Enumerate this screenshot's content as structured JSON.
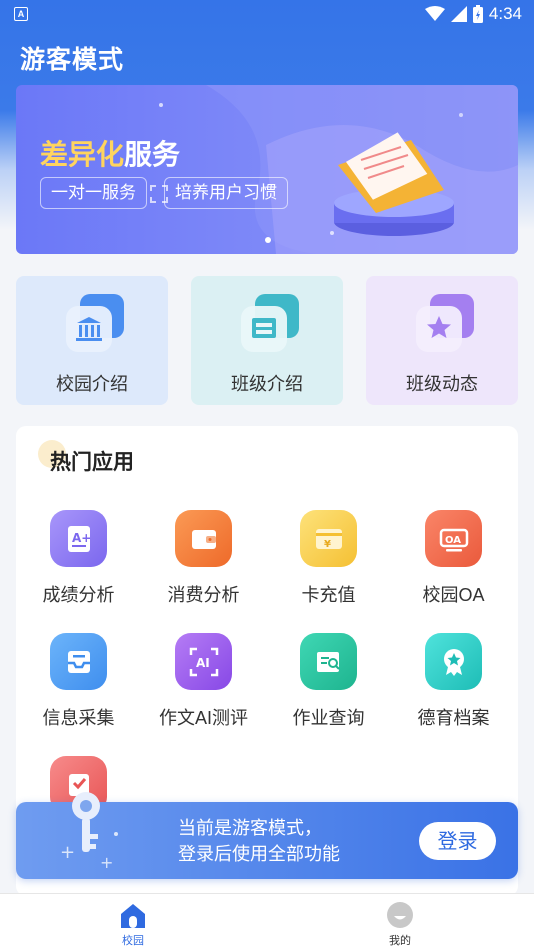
{
  "status_bar": {
    "time": "4:34",
    "indicator": "A"
  },
  "header": {
    "title": "游客模式"
  },
  "banner": {
    "title_highlight": "差异化",
    "title_rest": "服务",
    "tags": [
      "一对一服务",
      "培养用户习惯"
    ],
    "page_indicator": {
      "current": 1,
      "total": 1
    }
  },
  "quick_links": [
    {
      "label": "校园介绍",
      "icon": "school-building-icon",
      "color": "#4a8ef0"
    },
    {
      "label": "班级介绍",
      "icon": "class-board-icon",
      "color": "#3fb8c8"
    },
    {
      "label": "班级动态",
      "icon": "star-icon",
      "color": "#a47ff0"
    }
  ],
  "hot_apps": {
    "title": "热门应用",
    "items": [
      {
        "label": "成绩分析",
        "icon": "grade-a-plus-icon",
        "color": "#8f7cf5"
      },
      {
        "label": "消费分析",
        "icon": "wallet-icon",
        "color": "#f27a3a"
      },
      {
        "label": "卡充值",
        "icon": "card-recharge-icon",
        "color": "#f5c542"
      },
      {
        "label": "校园OA",
        "icon": "oa-icon",
        "color": "#f06a4e"
      },
      {
        "label": "信息采集",
        "icon": "inbox-icon",
        "color": "#4a9cf2"
      },
      {
        "label": "作文AI测评",
        "icon": "ai-scan-icon",
        "color": "#9d62ee"
      },
      {
        "label": "作业查询",
        "icon": "homework-search-icon",
        "color": "#2bc4a8"
      },
      {
        "label": "德育档案",
        "icon": "award-badge-icon",
        "color": "#34c9c4"
      },
      {
        "label": "",
        "icon": "checklist-clock-icon",
        "color": "#ef5e5e"
      }
    ]
  },
  "guest_notice": {
    "line1": "当前是游客模式，",
    "line2": "登录后使用全部功能",
    "button": "登录"
  },
  "tab_bar": {
    "tabs": [
      {
        "label": "校园",
        "icon": "home-icon",
        "active": true
      },
      {
        "label": "我的",
        "icon": "profile-icon",
        "active": false
      }
    ],
    "active_color": "#2f6ae0",
    "inactive_color": "#333333"
  }
}
